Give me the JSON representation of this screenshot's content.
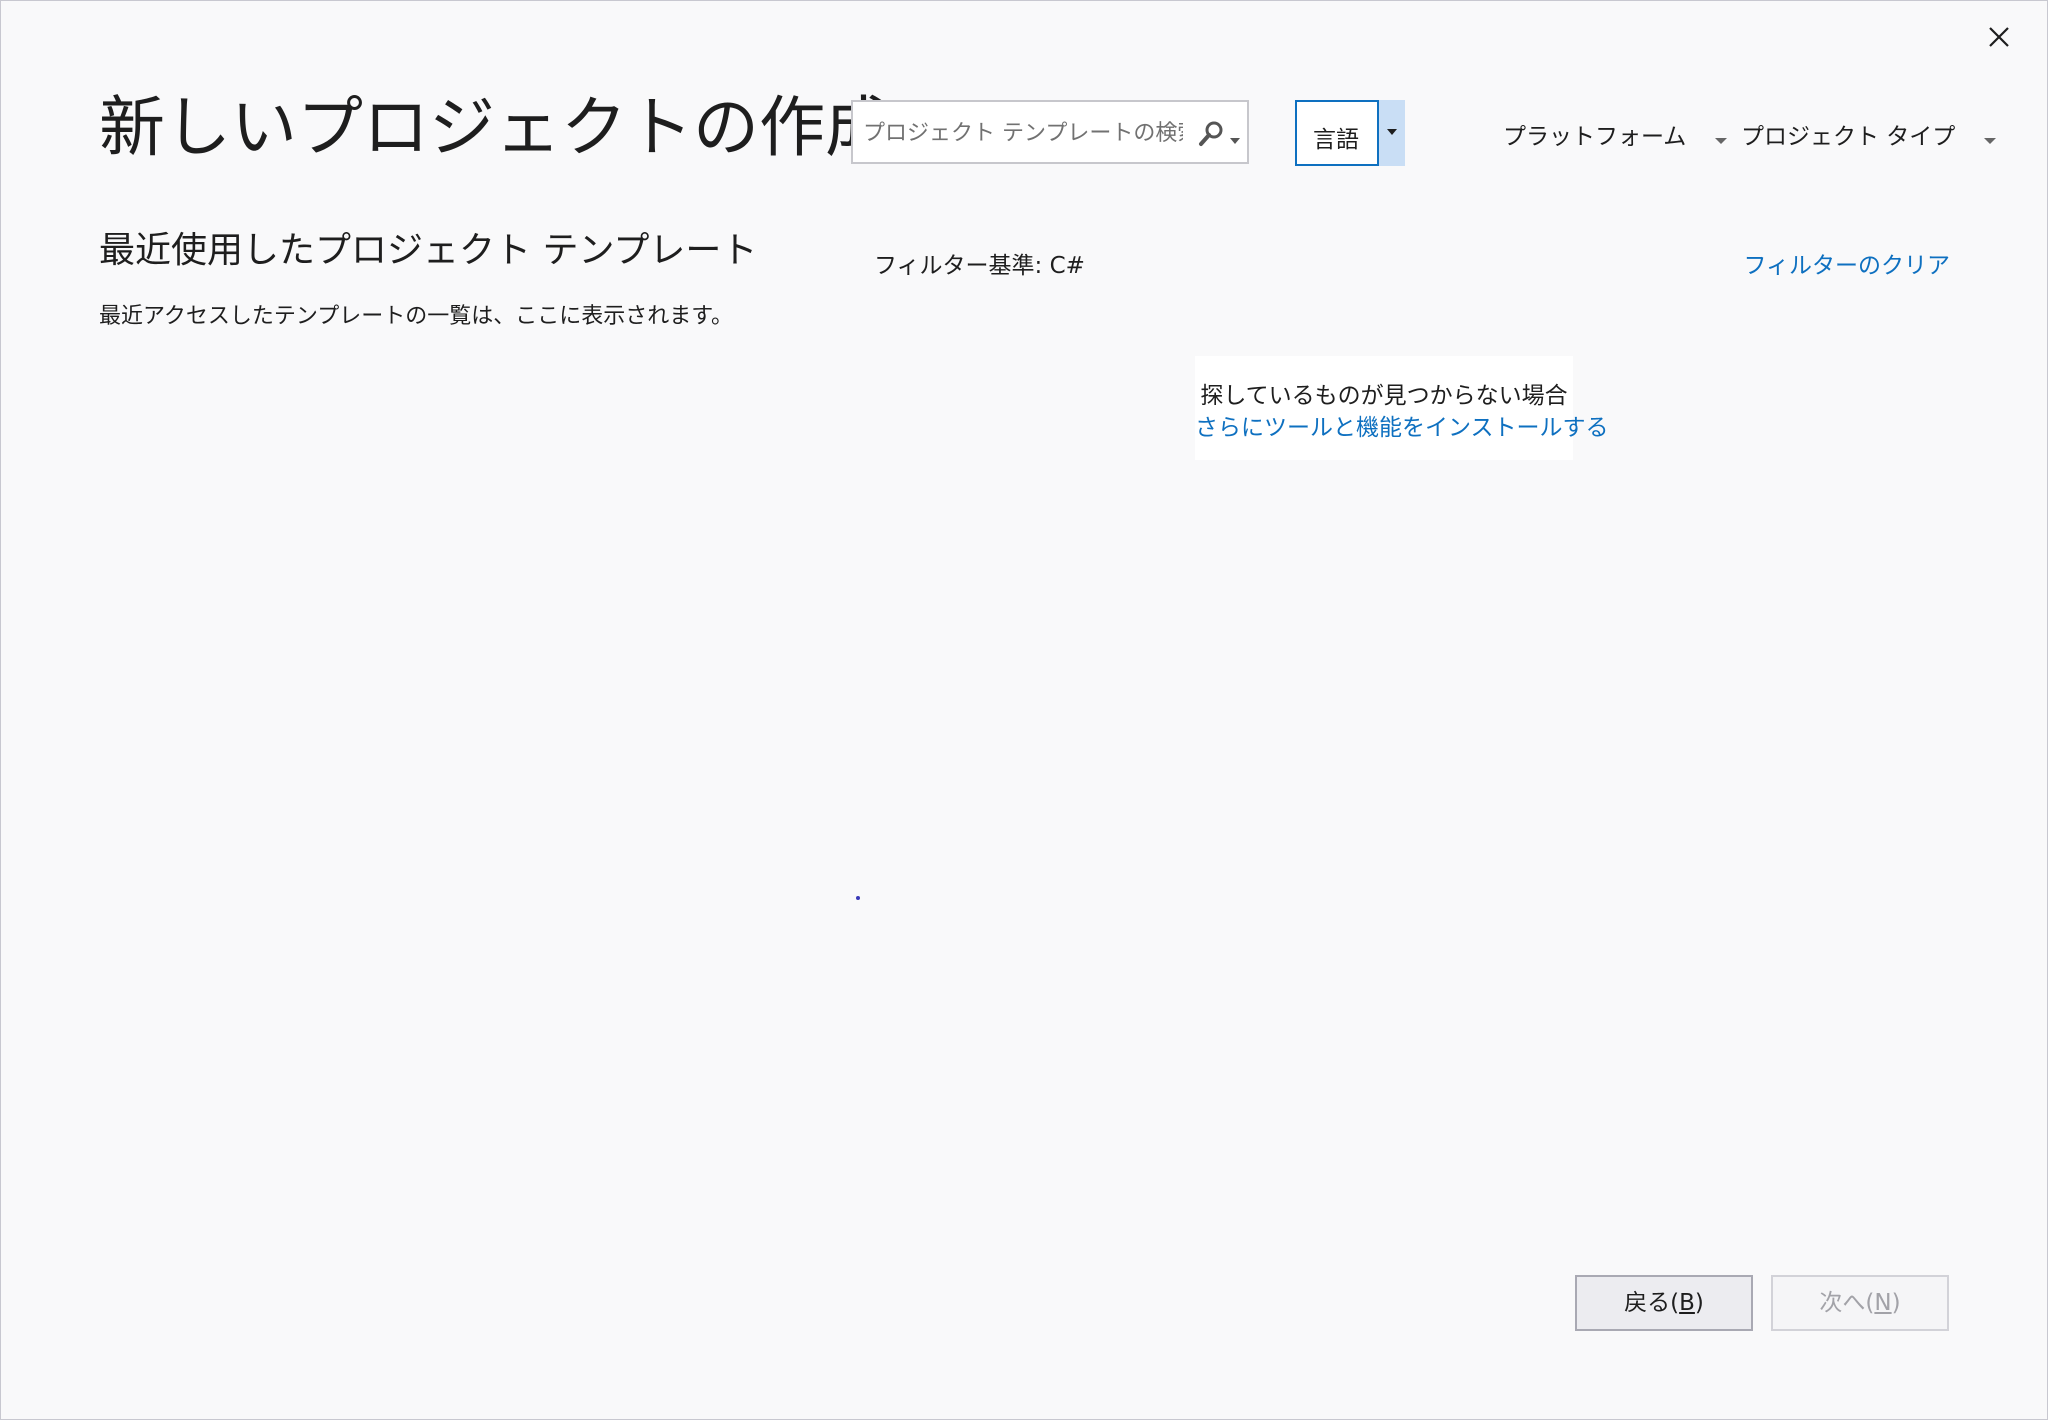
{
  "dialog": {
    "title": "新しいプロジェクトの作成"
  },
  "search": {
    "placeholder": "プロジェクト テンプレートの検索",
    "value": ""
  },
  "filters": {
    "language_label": "言語",
    "platform_label": "プラットフォーム",
    "project_type_label": "プロジェクト タイプ"
  },
  "recent": {
    "title": "最近使用したプロジェクト テンプレート",
    "description": "最近アクセスしたテンプレートの一覧は、ここに表示されます。"
  },
  "results": {
    "filter_status": "フィルター基準: C#",
    "clear_filter_label": "フィルターのクリア",
    "not_found_text": "探しているものが見つからない場合",
    "install_link_label": "さらにツールと機能をインストールする"
  },
  "footer": {
    "back_label": "戻る(",
    "back_key": "B",
    "back_end": ")",
    "next_label": "次へ(",
    "next_key": "N",
    "next_end": ")"
  },
  "colors": {
    "accent": "#0e70c0",
    "background": "#f9f9fa",
    "text": "#1e1e1e",
    "disabled_text": "#a2a2a8"
  }
}
